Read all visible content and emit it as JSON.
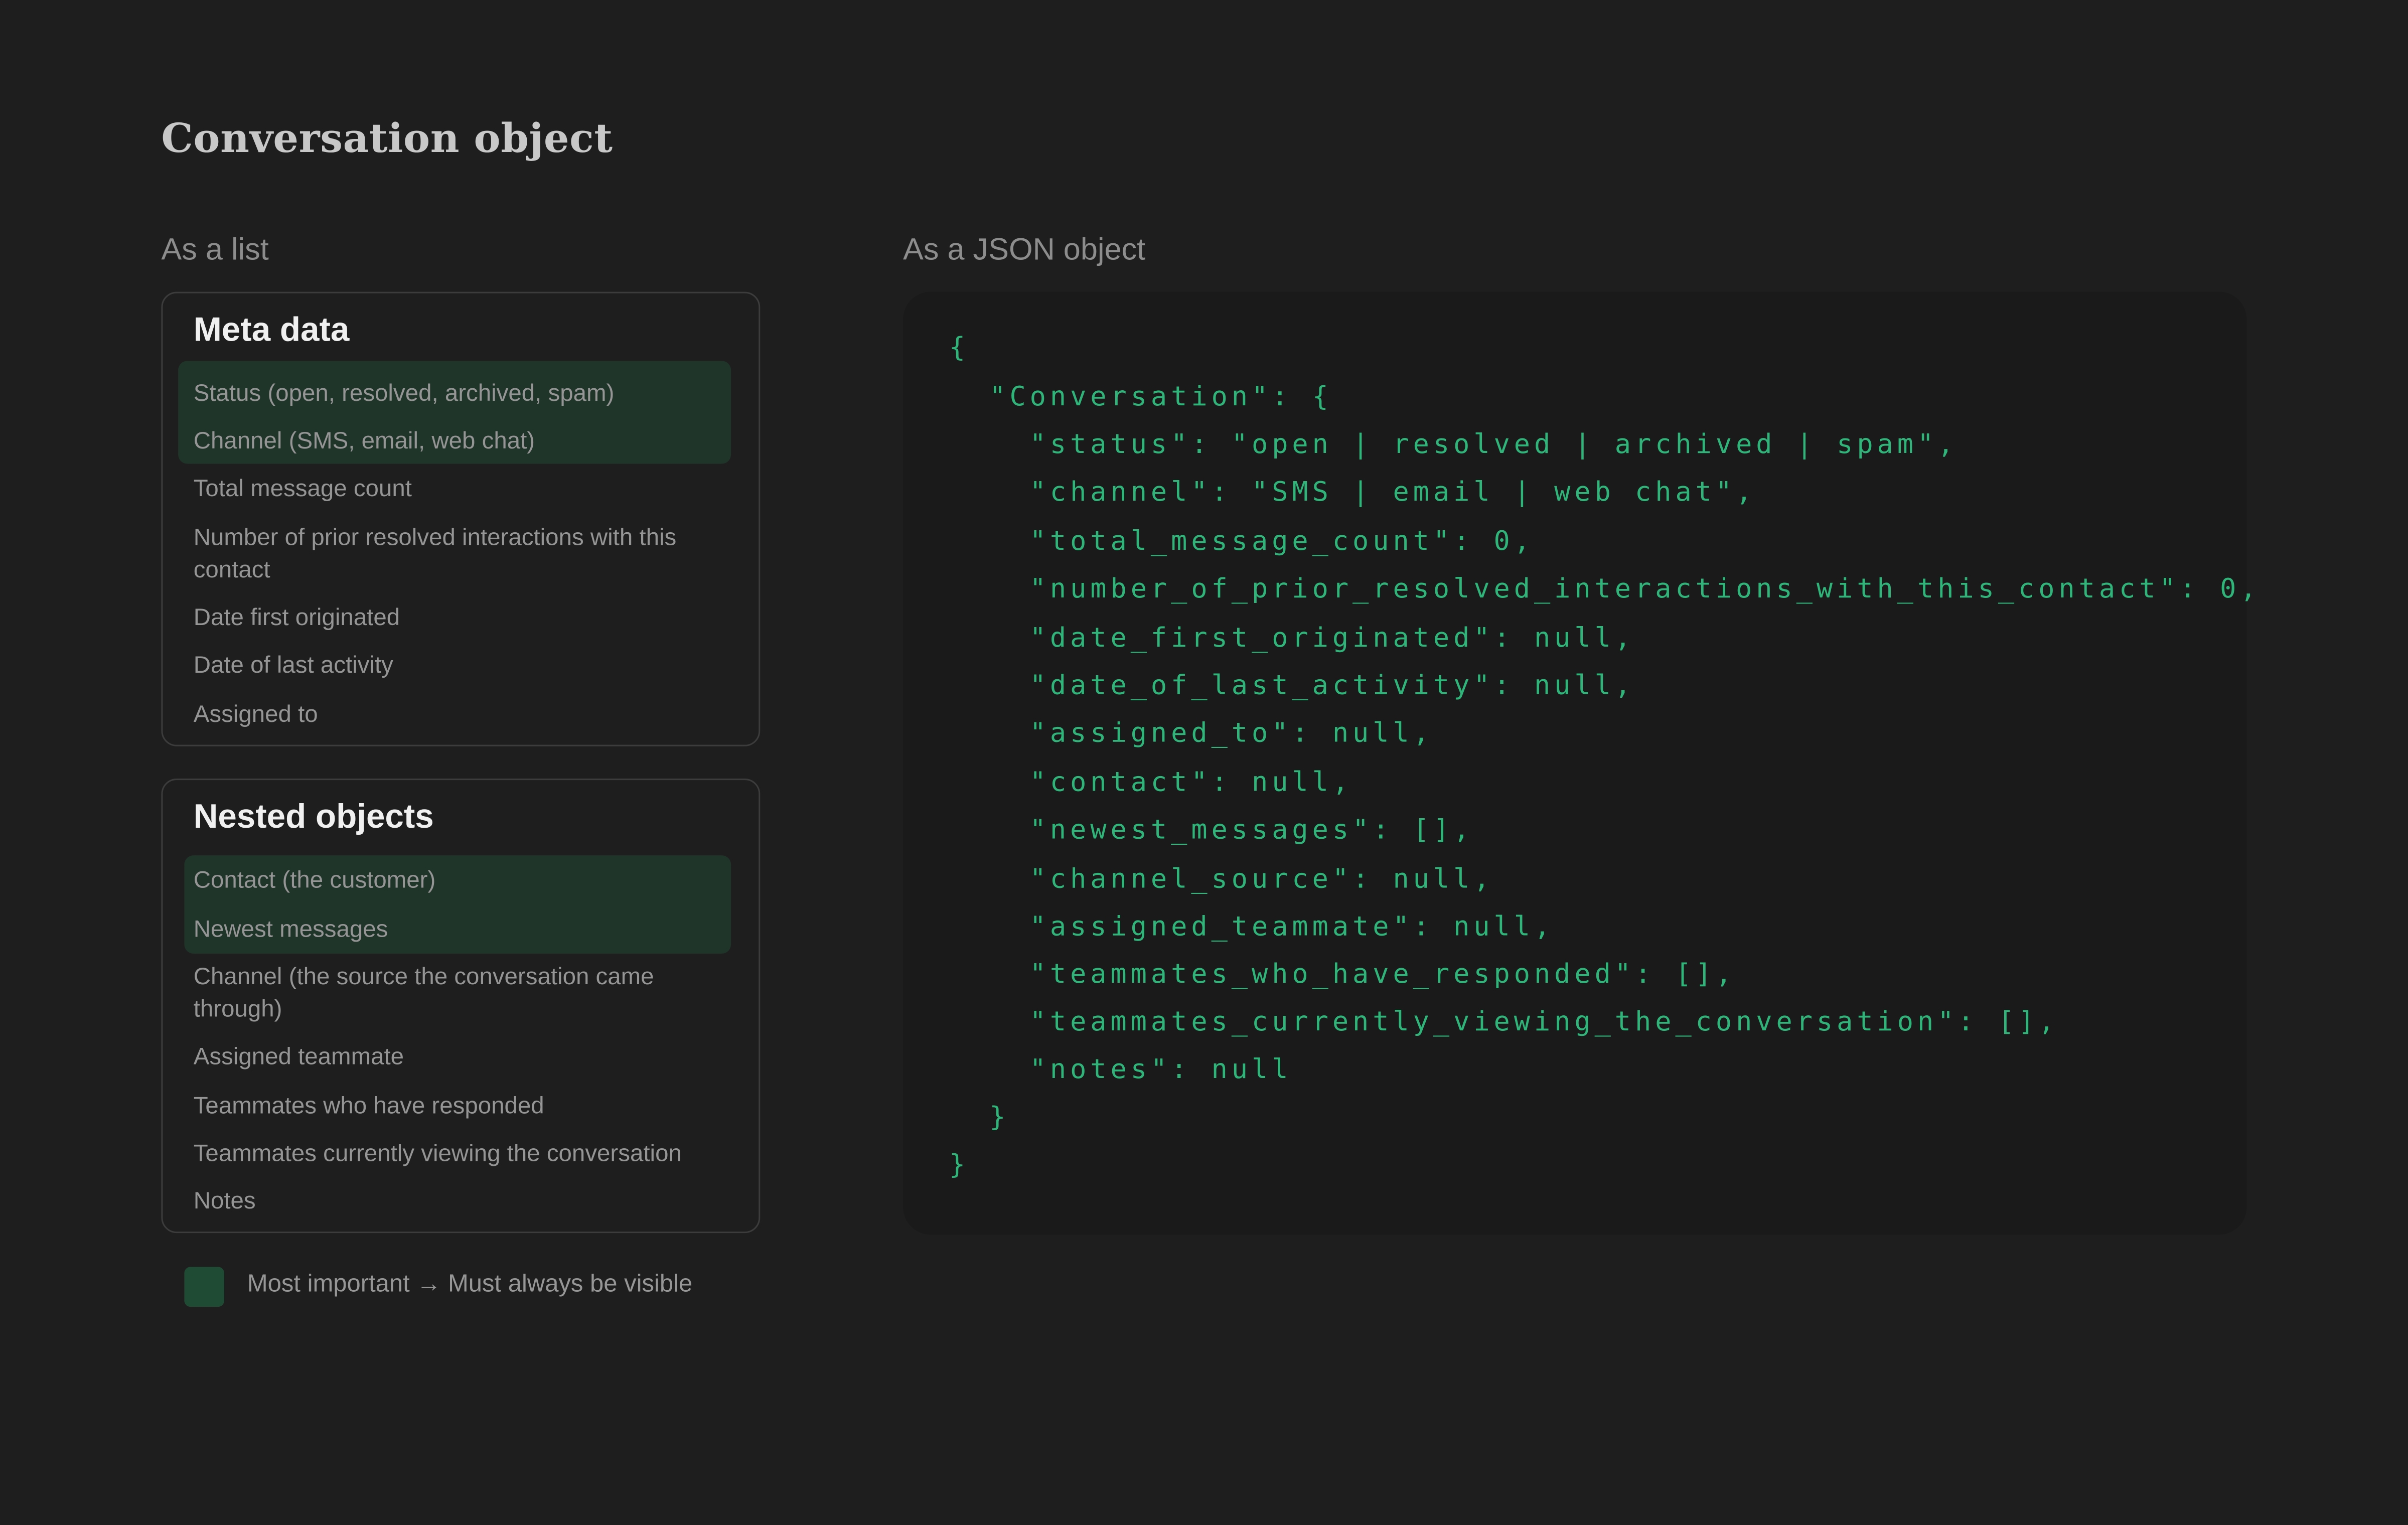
{
  "page": {
    "title": "Conversation object",
    "list_label": "As a list",
    "json_label": "As a JSON object"
  },
  "meta_card": {
    "title": "Meta data",
    "items": [
      "Status (open, resolved, archived, spam)",
      "Channel (SMS, email, web chat)",
      "Total message count",
      "Number of prior resolved interactions with this contact",
      "Date first originated",
      "Date of last activity",
      "Assigned to"
    ],
    "highlighted_count": 2
  },
  "nested_card": {
    "title": "Nested objects",
    "items": [
      "Contact (the customer)",
      "Newest messages",
      "Channel (the source the conversation came through)",
      "Assigned teammate",
      "Teammates who have responded",
      "Teammates currently viewing the conversation",
      "Notes"
    ],
    "highlighted_count": 2
  },
  "legend": {
    "text": "Most important → Must always be visible"
  },
  "json_lines": [
    "{",
    "  \"Conversation\": {",
    "    \"status\": \"open | resolved | archived | spam\",",
    "    \"channel\": \"SMS | email | web chat\",",
    "    \"total_message_count\": 0,",
    "    \"number_of_prior_resolved_interactions_with_this_contact\": 0,",
    "    \"date_first_originated\": null,",
    "    \"date_of_last_activity\": null,",
    "    \"assigned_to\": null,",
    "    \"contact\": null,",
    "    \"newest_messages\": [],",
    "    \"channel_source\": null,",
    "    \"assigned_teammate\": null,",
    "    \"teammates_who_have_responded\": [],",
    "    \"teammates_currently_viewing_the_conversation\": [],",
    "    \"notes\": null",
    "  }",
    "}"
  ],
  "colors": {
    "background": "#1e1e1e",
    "highlight": "#1f3529",
    "code": "#2fb57a"
  }
}
